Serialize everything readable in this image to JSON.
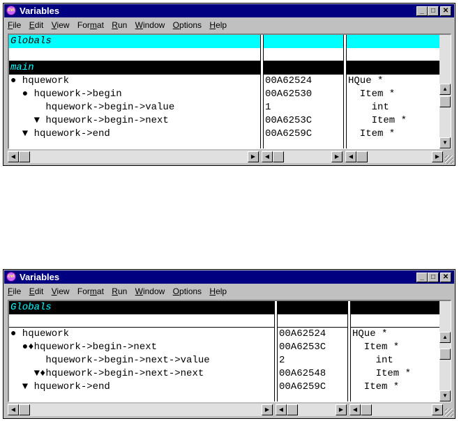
{
  "colors": {
    "cyan": "#00ffff",
    "black": "#000000",
    "titlebar": "#000080"
  },
  "menu": [
    "File",
    "Edit",
    "View",
    "Format",
    "Run",
    "Window",
    "Options",
    "Help"
  ],
  "windows": [
    {
      "title": "Variables",
      "rows": [
        {
          "name": "Globals",
          "addr": "",
          "type": "",
          "style": "header-cyan"
        },
        {
          "name": "",
          "addr": "",
          "type": "",
          "style": "blank"
        },
        {
          "name": "main",
          "addr": "",
          "type": "",
          "style": "header-black"
        },
        {
          "name": "● hquework",
          "addr": "00A62524",
          "type": "HQue *",
          "style": "normal"
        },
        {
          "name": "  ● hquework->begin",
          "addr": "00A62530",
          "type": "  Item *",
          "style": "normal"
        },
        {
          "name": "      hquework->begin->value",
          "addr": "1",
          "type": "    int",
          "style": "normal"
        },
        {
          "name": "    ▼ hquework->begin->next",
          "addr": "00A6253C",
          "type": "    Item *",
          "style": "normal"
        },
        {
          "name": "  ▼ hquework->end",
          "addr": "00A6259C",
          "type": "  Item *",
          "style": "normal"
        }
      ]
    },
    {
      "title": "Variables",
      "rows": [
        {
          "name": "Globals",
          "addr": "",
          "type": "",
          "style": "header-black"
        },
        {
          "name": "",
          "addr": "",
          "type": "",
          "style": "blank"
        },
        {
          "name": "● hquework",
          "addr": "00A62524",
          "type": "HQue *",
          "style": "normal"
        },
        {
          "name": "  ●♦hquework->begin->next",
          "addr": "00A6253C",
          "type": "  Item *",
          "style": "normal"
        },
        {
          "name": "      hquework->begin->next->value",
          "addr": "2",
          "type": "    int",
          "style": "normal"
        },
        {
          "name": "    ▼♦hquework->begin->next->next",
          "addr": "00A62548",
          "type": "    Item *",
          "style": "normal"
        },
        {
          "name": "  ▼ hquework->end",
          "addr": "00A6259C",
          "type": "  Item *",
          "style": "normal"
        }
      ]
    }
  ]
}
